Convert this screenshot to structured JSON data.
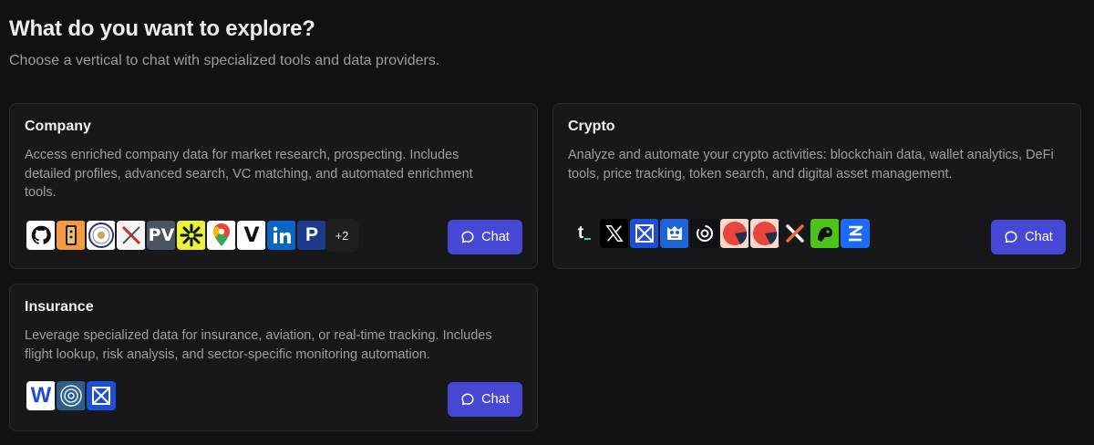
{
  "header": {
    "title": "What do you want to explore?",
    "subtitle": "Choose a vertical to chat with specialized tools and data providers."
  },
  "cards": {
    "company": {
      "title": "Company",
      "description": "Access enriched company data for market research, prospecting. Includes detailed profiles, advanced search, VC matching, and automated enrichment tools.",
      "button_label": "Chat",
      "more_count": "+2",
      "logos": [
        "github-icon",
        "cheese-icon",
        "sec-seal-icon",
        "crossed-x-icon",
        "pv-icon",
        "burst-icon",
        "google-maps-icon",
        "v-icon",
        "linkedin-icon",
        "p-icon"
      ]
    },
    "crypto": {
      "title": "Crypto",
      "description": "Analyze and automate your crypto activities: blockchain data, wallet analytics, DeFi tools, price tracking, token search, and digital asset management.",
      "button_label": "Chat",
      "logos": [
        "t-icon",
        "x-icon",
        "hourglass-icon",
        "owl-icon",
        "swirl-icon",
        "pie-icon",
        "pie-icon",
        "x-logo-icon",
        "dragon-icon",
        "z-icon"
      ]
    },
    "insurance": {
      "title": "Insurance",
      "description": "Leverage specialized data for insurance, aviation, or real-time tracking. Includes flight lookup, risk analysis, and sector-specific monitoring automation.",
      "button_label": "Chat",
      "logos": [
        "w-icon",
        "target-icon",
        "hourglass-icon"
      ]
    }
  },
  "logo_text": {
    "pv": "PV",
    "v": "V",
    "p": "P",
    "t": "t",
    "w": "W"
  },
  "colors": {
    "background": "#111113",
    "card": "#18181b",
    "accent": "#4747d6"
  }
}
